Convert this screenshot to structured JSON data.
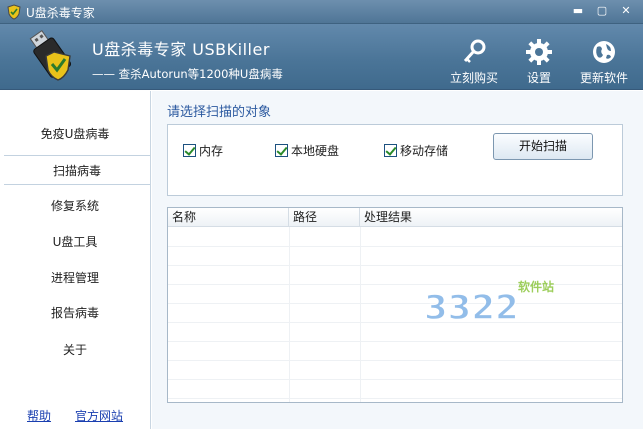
{
  "window": {
    "title": "U盘杀毒专家",
    "controls": {
      "minimize": "▬",
      "maximize": "▢",
      "close": "✕"
    }
  },
  "header": {
    "app_title": "U盘杀毒专家  USBKiller",
    "subtitle": "—— 查杀Autorun等1200种U盘病毒",
    "buttons": [
      {
        "label": "立刻购买",
        "icon": "key-icon"
      },
      {
        "label": "设置",
        "icon": "gear-icon"
      },
      {
        "label": "更新软件",
        "icon": "globe-icon"
      }
    ]
  },
  "sidebar": {
    "items": [
      {
        "label": "免疫U盘病毒"
      },
      {
        "label": "扫描病毒",
        "active": true
      },
      {
        "label": "修复系统"
      },
      {
        "label": "U盘工具"
      },
      {
        "label": "进程管理"
      },
      {
        "label": "报告病毒"
      },
      {
        "label": "关于"
      }
    ],
    "footer_links": {
      "help": "帮助",
      "website": "官方网站"
    }
  },
  "main": {
    "title": "请选择扫描的对象",
    "options": [
      {
        "label": "内存",
        "checked": true
      },
      {
        "label": "本地硬盘",
        "checked": true
      },
      {
        "label": "移动存储",
        "checked": true
      }
    ],
    "scan_button": "开始扫描",
    "table": {
      "columns": [
        "名称",
        "路径",
        "处理结果"
      ],
      "rows": []
    }
  },
  "watermark": {
    "text": "软件站",
    "number": "3322"
  },
  "colors": {
    "header_bg": "#4b7598",
    "title_accent": "#2c5aa0",
    "link": "#1a3fb0",
    "check": "#2a8a2a"
  }
}
